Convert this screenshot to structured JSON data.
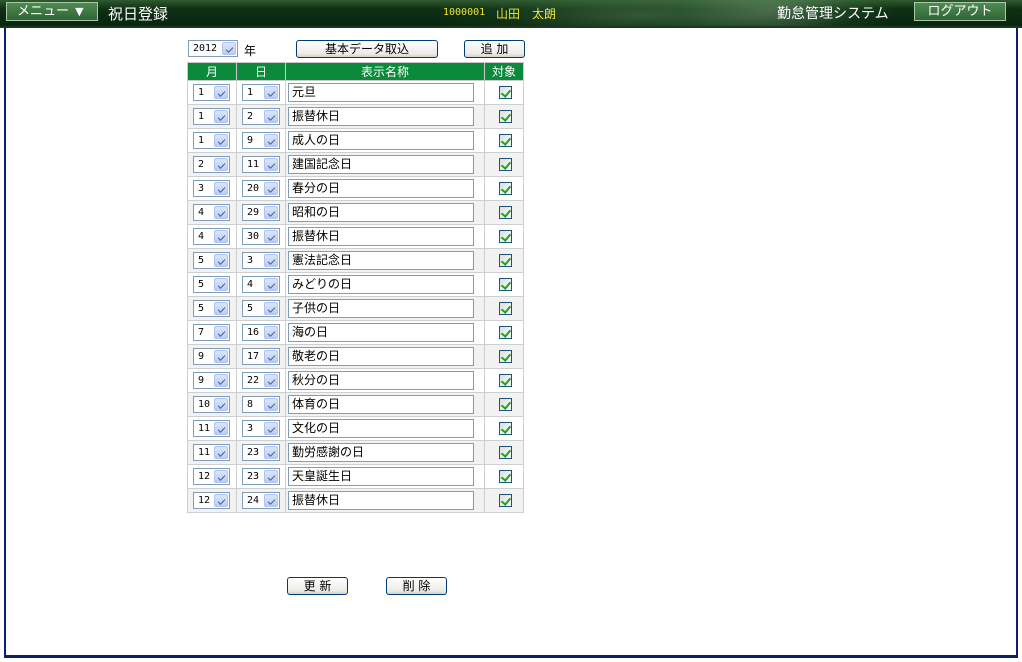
{
  "header": {
    "menu_label": "メニュー",
    "menu_arrow": "▼",
    "page_title": "祝日登録",
    "user_id": "1000001",
    "user_name": "山田　太朗",
    "system_name": "勤怠管理システム",
    "logout_label": "ログアウト"
  },
  "toolbar": {
    "year_value": "2012",
    "year_label": "年",
    "import_label": "基本データ取込",
    "add_label": "追 加"
  },
  "table": {
    "columns": [
      "月",
      "日",
      "表示名称",
      "対象"
    ],
    "rows": [
      {
        "month": "1",
        "day": "1",
        "name": "元旦",
        "checked": true
      },
      {
        "month": "1",
        "day": "2",
        "name": "振替休日",
        "checked": true
      },
      {
        "month": "1",
        "day": "9",
        "name": "成人の日",
        "checked": true
      },
      {
        "month": "2",
        "day": "11",
        "name": "建国記念日",
        "checked": true
      },
      {
        "month": "3",
        "day": "20",
        "name": "春分の日",
        "checked": true
      },
      {
        "month": "4",
        "day": "29",
        "name": "昭和の日",
        "checked": true
      },
      {
        "month": "4",
        "day": "30",
        "name": "振替休日",
        "checked": true
      },
      {
        "month": "5",
        "day": "3",
        "name": "憲法記念日",
        "checked": true
      },
      {
        "month": "5",
        "day": "4",
        "name": "みどりの日",
        "checked": true
      },
      {
        "month": "5",
        "day": "5",
        "name": "子供の日",
        "checked": true
      },
      {
        "month": "7",
        "day": "16",
        "name": "海の日",
        "checked": true
      },
      {
        "month": "9",
        "day": "17",
        "name": "敬老の日",
        "checked": true
      },
      {
        "month": "9",
        "day": "22",
        "name": "秋分の日",
        "checked": true
      },
      {
        "month": "10",
        "day": "8",
        "name": "体育の日",
        "checked": true
      },
      {
        "month": "11",
        "day": "3",
        "name": "文化の日",
        "checked": true
      },
      {
        "month": "11",
        "day": "23",
        "name": "勤労感謝の日",
        "checked": true
      },
      {
        "month": "12",
        "day": "23",
        "name": "天皇誕生日",
        "checked": true
      },
      {
        "month": "12",
        "day": "24",
        "name": "振替休日",
        "checked": true
      }
    ]
  },
  "footer": {
    "update_label": "更 新",
    "delete_label": "削 除"
  },
  "colors": {
    "header_bg": "#0f2f14",
    "table_header_bg": "#0a8a3a",
    "user_text": "#f2e437",
    "frame_border": "#0a1f6d"
  }
}
